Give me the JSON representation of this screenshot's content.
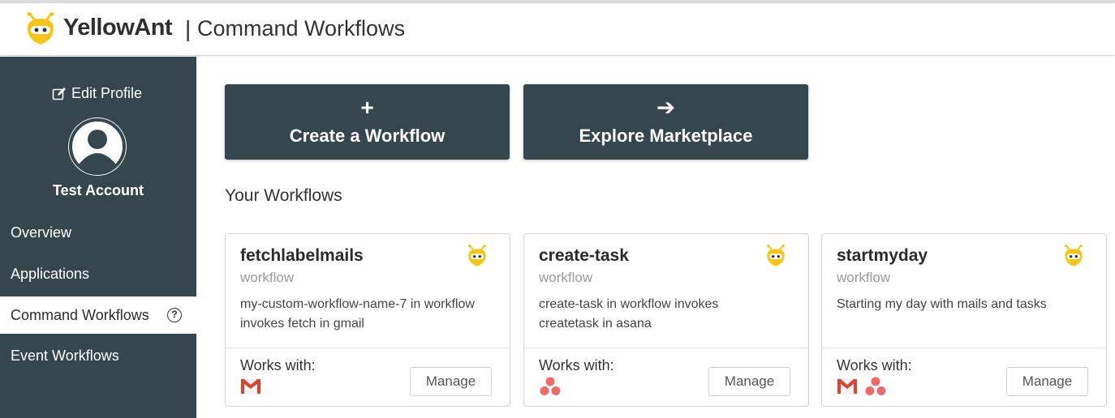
{
  "header": {
    "brand": "YellowAnt",
    "separator": "|",
    "title": "Command Workflows",
    "logo_icon": "yellowant-logo-icon"
  },
  "sidebar": {
    "edit_profile": "Edit Profile",
    "edit_icon": "edit-icon",
    "account_name": "Test Account",
    "avatar_icon": "user-avatar-icon",
    "nav": [
      {
        "label": "Overview",
        "active": false
      },
      {
        "label": "Applications",
        "active": false
      },
      {
        "label": "Command Workflows",
        "active": true,
        "help": "?"
      },
      {
        "label": "Event Workflows",
        "active": false
      }
    ]
  },
  "actions": {
    "create": {
      "glyph": "+",
      "label": "Create a Workflow",
      "icon": "plus-icon"
    },
    "explore": {
      "glyph": "➔",
      "label": "Explore Marketplace",
      "icon": "arrow-right-icon"
    }
  },
  "section_title": "Your Workflows",
  "workflows": [
    {
      "name": "fetchlabelmails",
      "type": "workflow",
      "description": "my-custom-workflow-name-7 in workflow invokes fetch in gmail",
      "works_with_label": "Works with:",
      "apps": [
        "gmail-icon"
      ],
      "manage_label": "Manage"
    },
    {
      "name": "create-task",
      "type": "workflow",
      "description": "create-task in workflow invokes createtask in asana",
      "works_with_label": "Works with:",
      "apps": [
        "asana-icon"
      ],
      "manage_label": "Manage"
    },
    {
      "name": "startmyday",
      "type": "workflow",
      "description": "Starting my day with mails and tasks",
      "works_with_label": "Works with:",
      "apps": [
        "gmail-icon",
        "asana-icon"
      ],
      "manage_label": "Manage"
    }
  ],
  "colors": {
    "sidebar_bg": "#36464f",
    "accent_yellow": "#f5c518",
    "gmail_red": "#d44638",
    "asana_pink": "#f06a6a"
  }
}
